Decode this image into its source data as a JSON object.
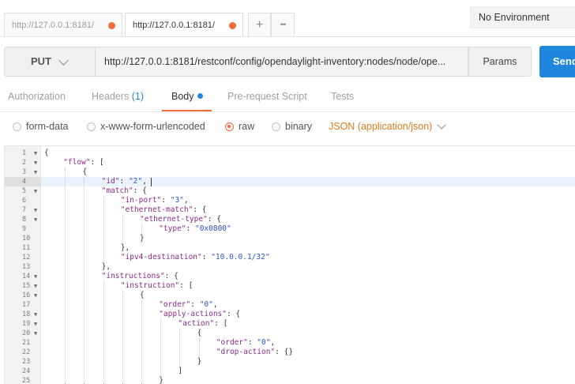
{
  "tabs": [
    {
      "label": "http://127.0.0.1:8181/",
      "active": false
    },
    {
      "label": "http://127.0.0.1:8181/",
      "active": true
    }
  ],
  "tab_actions": {
    "add_symbol": "+",
    "more_symbol": "•••"
  },
  "environment": {
    "selected": "No Environment"
  },
  "request": {
    "method": "PUT",
    "url": "http://127.0.0.1:8181/restconf/config/opendaylight-inventory:nodes/node/ope...",
    "params_label": "Params",
    "send_label": "Send"
  },
  "subtabs": [
    {
      "label": "Authorization"
    },
    {
      "label": "Headers",
      "count": "(1)"
    },
    {
      "label": "Body"
    },
    {
      "label": "Pre-request Script"
    },
    {
      "label": "Tests"
    }
  ],
  "body_modes": [
    {
      "label": "form-data",
      "selected": false
    },
    {
      "label": "x-www-form-urlencoded",
      "selected": false
    },
    {
      "label": "raw",
      "selected": true
    },
    {
      "label": "binary",
      "selected": false
    }
  ],
  "content_type": "JSON (application/json)",
  "colors": {
    "accent": "#f26b3a",
    "primary": "#1f88dd",
    "json_key": "#8b2a8b",
    "json_string": "#2a54c4"
  },
  "editor": {
    "cursor_line": 4,
    "lines": [
      {
        "n": "1",
        "fold": true,
        "indent": 0,
        "text": "{"
      },
      {
        "n": "2",
        "fold": true,
        "indent": 1,
        "text": "\"flow\": ["
      },
      {
        "n": "3",
        "fold": true,
        "indent": 2,
        "text": "{"
      },
      {
        "n": "4",
        "fold": false,
        "indent": 3,
        "text": "\"id\": \"2\","
      },
      {
        "n": "5",
        "fold": true,
        "indent": 3,
        "text": "\"match\": {"
      },
      {
        "n": "6",
        "fold": false,
        "indent": 4,
        "text": "\"in-port\": \"3\","
      },
      {
        "n": "7",
        "fold": true,
        "indent": 4,
        "text": "\"ethernet-match\": {"
      },
      {
        "n": "8",
        "fold": true,
        "indent": 5,
        "text": "\"ethernet-type\": {"
      },
      {
        "n": "9",
        "fold": false,
        "indent": 6,
        "text": "\"type\": \"0x0800\""
      },
      {
        "n": "10",
        "fold": false,
        "indent": 5,
        "text": "}"
      },
      {
        "n": "11",
        "fold": false,
        "indent": 4,
        "text": "},"
      },
      {
        "n": "12",
        "fold": false,
        "indent": 4,
        "text": "\"ipv4-destination\": \"10.0.0.1/32\""
      },
      {
        "n": "13",
        "fold": false,
        "indent": 3,
        "text": "},"
      },
      {
        "n": "14",
        "fold": true,
        "indent": 3,
        "text": "\"instructions\": {"
      },
      {
        "n": "15",
        "fold": true,
        "indent": 4,
        "text": "\"instruction\": ["
      },
      {
        "n": "16",
        "fold": true,
        "indent": 5,
        "text": "{"
      },
      {
        "n": "17",
        "fold": false,
        "indent": 6,
        "text": "\"order\": \"0\","
      },
      {
        "n": "18",
        "fold": true,
        "indent": 6,
        "text": "\"apply-actions\": {"
      },
      {
        "n": "19",
        "fold": true,
        "indent": 7,
        "text": "\"action\": ["
      },
      {
        "n": "20",
        "fold": true,
        "indent": 8,
        "text": "{"
      },
      {
        "n": "21",
        "fold": false,
        "indent": 9,
        "text": "\"order\": \"0\","
      },
      {
        "n": "22",
        "fold": false,
        "indent": 9,
        "text": "\"drop-action\": {}"
      },
      {
        "n": "23",
        "fold": false,
        "indent": 8,
        "text": "}"
      },
      {
        "n": "24",
        "fold": false,
        "indent": 7,
        "text": "]"
      },
      {
        "n": "25",
        "fold": false,
        "indent": 6,
        "text": "}"
      }
    ]
  }
}
